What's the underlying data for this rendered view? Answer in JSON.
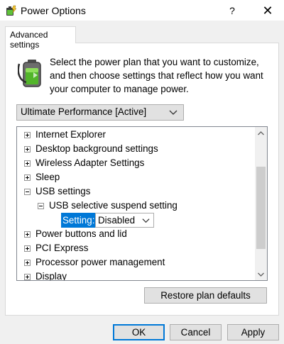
{
  "window": {
    "title": "Power Options",
    "help_label": "?",
    "close_label": "✕"
  },
  "tab": {
    "label": "Advanced settings"
  },
  "description": "Select the power plan that you want to customize, and then choose settings that reflect how you want your computer to manage power.",
  "plan_select": {
    "value": "Ultimate Performance [Active]"
  },
  "tree": {
    "items": [
      {
        "label": "Internet Explorer",
        "expander": "+"
      },
      {
        "label": "Desktop background settings",
        "expander": "+"
      },
      {
        "label": "Wireless Adapter Settings",
        "expander": "+"
      },
      {
        "label": "Sleep",
        "expander": "+"
      },
      {
        "label": "USB settings",
        "expander": "-"
      },
      {
        "label": "USB selective suspend setting",
        "expander": "-"
      },
      {
        "label": "Power buttons and lid",
        "expander": "+"
      },
      {
        "label": "PCI Express",
        "expander": "+"
      },
      {
        "label": "Processor power management",
        "expander": "+"
      },
      {
        "label": "Display",
        "expander": "+"
      }
    ],
    "setting": {
      "label": "Setting:",
      "value": "Disabled"
    }
  },
  "buttons": {
    "restore": "Restore plan defaults",
    "ok": "OK",
    "cancel": "Cancel",
    "apply": "Apply"
  },
  "colors": {
    "accent": "#0078d7",
    "battery_green": "#4caf2a"
  }
}
